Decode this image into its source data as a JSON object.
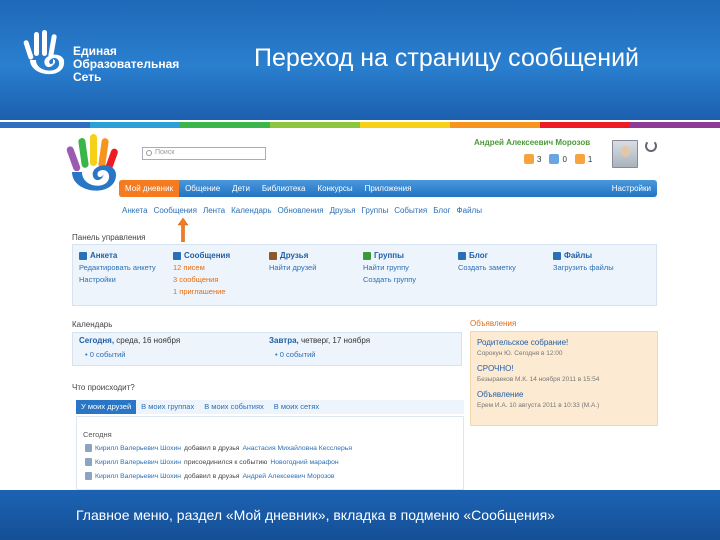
{
  "slide": {
    "logo_lines": [
      "Единая",
      "Образовательная",
      "Сеть"
    ],
    "title": "Переход на страницу сообщений",
    "caption": "Главное меню, раздел «Мой дневник», вкладка в подменю «Сообщения»",
    "strip_colors": [
      "#2f6fc1",
      "#2a9fd8",
      "#39b54a",
      "#8cc63f",
      "#f7d117",
      "#f7941d",
      "#ed1c24",
      "#8f3a96"
    ]
  },
  "site": {
    "search_placeholder": "Поиск",
    "user_name": "Андрей Алексеевич Морозов",
    "counters": [
      {
        "icon": "envelope-icon",
        "value": "3",
        "color": "#f7a340"
      },
      {
        "icon": "person-icon",
        "value": "0",
        "color": "#6aa6e0"
      },
      {
        "icon": "group-icon",
        "value": "1",
        "color": "#f7a340"
      }
    ],
    "main_nav": [
      "Мой дневник",
      "Общение",
      "Дети",
      "Библиотека",
      "Конкурсы",
      "Приложения"
    ],
    "main_nav_right": "Настройки",
    "sub_nav": [
      "Анкета",
      "Сообщения",
      "Лента",
      "Календарь",
      "Обновления",
      "Друзья",
      "Группы",
      "События",
      "Блог",
      "Файлы"
    ],
    "panel_title": "Панель управления",
    "panel_cols": [
      {
        "title": "Анкета",
        "icon": "profile-icon",
        "color": "#2b6fb6",
        "links": [
          "Редактировать анкету",
          "Настройки"
        ]
      },
      {
        "title": "Сообщения",
        "icon": "envelope-icon",
        "color": "#2b6fb6",
        "links": [
          "12 писем",
          "3 сообщения",
          "1 приглашение"
        ]
      },
      {
        "title": "Друзья",
        "icon": "friends-icon",
        "color": "#8a5a2b",
        "links": [
          "Найти друзей"
        ]
      },
      {
        "title": "Группы",
        "icon": "groups-icon",
        "color": "#3a9a3a",
        "links": [
          "Найти группу",
          "Создать группу"
        ]
      },
      {
        "title": "Блог",
        "icon": "blog-icon",
        "color": "#2b6fb6",
        "links": [
          "Создать заметку"
        ]
      },
      {
        "title": "Файлы",
        "icon": "files-icon",
        "color": "#2b6fb6",
        "links": [
          "Загрузить файлы"
        ]
      }
    ],
    "calendar_title": "Календарь",
    "calendar": [
      {
        "day": "Сегодня,",
        "date": "среда, 16 ноября",
        "events": "0 событий"
      },
      {
        "day": "Завтра,",
        "date": "четверг, 17 ноября",
        "events": "0 событий"
      }
    ],
    "announcements_title": "Объявления",
    "announcements": [
      {
        "title": "Родительское собрание!",
        "meta": "Сорокун Ю. Сегодня в 12:00"
      },
      {
        "title": "СРОЧНО!",
        "meta": "Безыраеков М.К. 14 ноября 2011 в 15:54"
      },
      {
        "title": "Объявление",
        "meta": "Ерем И.А. 10 августа 2011 в 10:33 (М.А.)"
      }
    ],
    "feed_title": "Что происходит?",
    "feed_tabs": [
      "У моих друзей",
      "В моих группах",
      "В моих событиях",
      "В моих сетях"
    ],
    "feed_today": "Сегодня",
    "feed_rows": [
      {
        "name": "Кирилл Валерьевич Шохин",
        "action": "добавил в друзья",
        "target": "Анастасия Михайловна Кесслерья"
      },
      {
        "name": "Кирилл Валерьевич Шохин",
        "action": "присоединился к событию",
        "target": "Новогодний марафон"
      },
      {
        "name": "Кирилл Валерьевич Шохин",
        "action": "добавил в друзья",
        "target": "Андрей Алексеевич Морозов"
      }
    ]
  }
}
